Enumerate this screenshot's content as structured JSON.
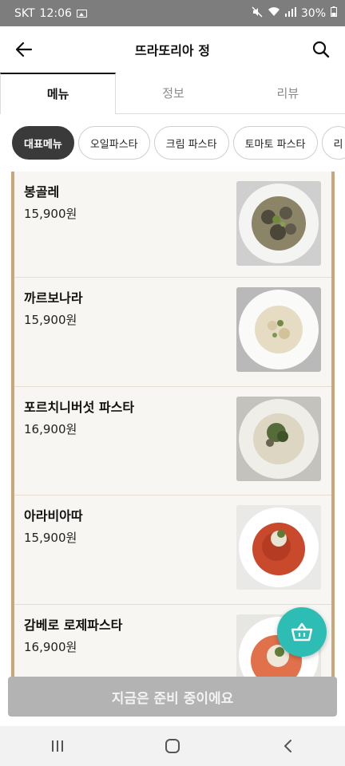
{
  "status_bar": {
    "carrier": "SKT",
    "time": "12:06",
    "battery": "30%"
  },
  "header": {
    "title": "뜨라또리아 정",
    "back_icon": "back-arrow-icon",
    "search_icon": "search-icon"
  },
  "tabs": [
    {
      "label": "메뉴",
      "active": true
    },
    {
      "label": "정보",
      "active": false
    },
    {
      "label": "리뷰",
      "active": false
    }
  ],
  "categories": [
    {
      "label": "대표메뉴",
      "active": true
    },
    {
      "label": "오일파스타",
      "active": false
    },
    {
      "label": "크림 파스타",
      "active": false
    },
    {
      "label": "토마토 파스타",
      "active": false
    },
    {
      "label": "리",
      "active": false
    }
  ],
  "menu_items": [
    {
      "name": "봉골레",
      "price": "15,900원"
    },
    {
      "name": "까르보나라",
      "price": "15,900원"
    },
    {
      "name": "포르치니버섯 파스타",
      "price": "16,900원"
    },
    {
      "name": "아라비아따",
      "price": "15,900원"
    },
    {
      "name": "감베로 로제파스타",
      "price": "16,900원"
    }
  ],
  "cart_button": {
    "icon": "basket-icon"
  },
  "cta": {
    "label": "지금은 준비 중이에요"
  },
  "colors": {
    "accent_teal": "#2ebdb5",
    "frame_tan": "#c9a77b",
    "chip_active": "#3a3a3a",
    "cta_disabled": "#b3b3b3"
  }
}
